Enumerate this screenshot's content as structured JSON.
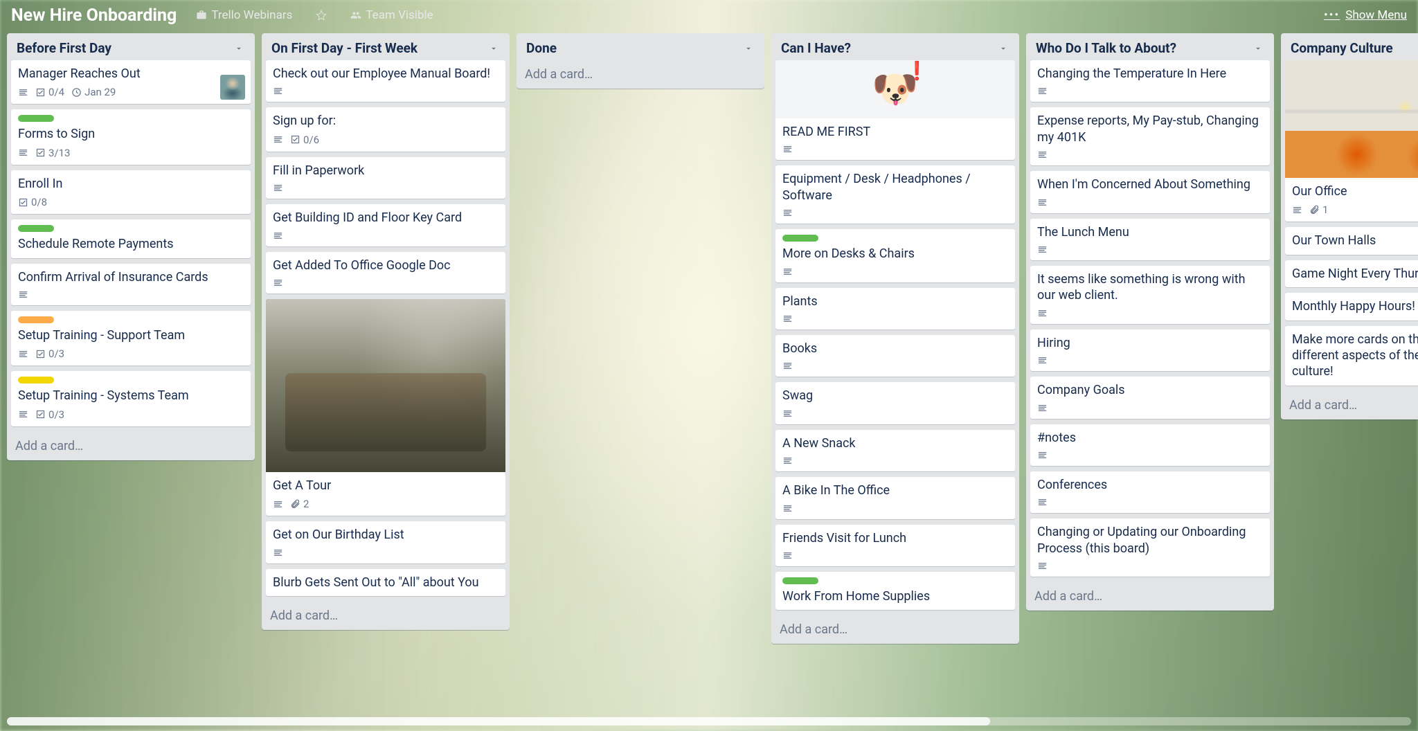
{
  "header": {
    "board_title": "New Hire Onboarding",
    "org_label": "Trello Webinars",
    "visibility_label": "Team Visible",
    "show_menu": "Show Menu"
  },
  "add_card_label": "Add a card…",
  "lists": [
    {
      "name": "Before First Day",
      "cards": [
        {
          "title": "Manager Reaches Out",
          "desc": true,
          "check": "0/4",
          "due": "Jan 29",
          "avatar": true
        },
        {
          "title": "Forms to Sign",
          "labels": [
            "green"
          ],
          "desc": true,
          "check": "3/13"
        },
        {
          "title": "Enroll In",
          "check": "0/8"
        },
        {
          "title": "Schedule Remote Payments",
          "labels": [
            "green"
          ]
        },
        {
          "title": "Confirm Arrival of Insurance Cards",
          "desc": true
        },
        {
          "title": "Setup Training - Support Team",
          "labels": [
            "orange"
          ],
          "desc": true,
          "check": "0/3"
        },
        {
          "title": "Setup Training - Systems Team",
          "labels": [
            "yellow"
          ],
          "desc": true,
          "check": "0/3"
        }
      ]
    },
    {
      "name": "On First Day - First Week",
      "cards": [
        {
          "title": "Check out our Employee Manual Board!",
          "desc": true
        },
        {
          "title": "Sign up for:",
          "desc": true,
          "check": "0/6"
        },
        {
          "title": "Fill in Paperwork",
          "desc": true
        },
        {
          "title": "Get Building ID and Floor Key Card",
          "desc": true
        },
        {
          "title": "Get Added To Office Google Doc",
          "desc": true
        },
        {
          "title": "Get A Tour",
          "desc": true,
          "attach": "2",
          "cover": "tour"
        },
        {
          "title": "Get on Our Birthday List",
          "desc": true
        },
        {
          "title": "Blurb Gets Sent Out to \"All\" about You"
        }
      ]
    },
    {
      "name": "Done",
      "cards": []
    },
    {
      "name": "Can I Have?",
      "cards": [
        {
          "title": "READ ME FIRST",
          "desc": true,
          "cover": "dog"
        },
        {
          "title": "Equipment / Desk / Headphones / Software",
          "desc": true
        },
        {
          "title": "More on Desks & Chairs",
          "labels": [
            "green"
          ],
          "desc": true
        },
        {
          "title": "Plants",
          "desc": true
        },
        {
          "title": "Books",
          "desc": true
        },
        {
          "title": "Swag",
          "desc": true
        },
        {
          "title": "A New Snack",
          "desc": true
        },
        {
          "title": "A Bike In The Office",
          "desc": true
        },
        {
          "title": "Friends Visit for Lunch",
          "desc": true
        },
        {
          "title": "Work From Home Supplies",
          "labels": [
            "green"
          ]
        }
      ]
    },
    {
      "name": "Who Do I Talk to About?",
      "cards": [
        {
          "title": "Changing the Temperature In Here",
          "desc": true
        },
        {
          "title": "Expense reports, My Pay-stub, Changing my 401K",
          "desc": true
        },
        {
          "title": "When I'm Concerned About Something",
          "desc": true
        },
        {
          "title": "The Lunch Menu",
          "desc": true
        },
        {
          "title": "It seems like something is wrong with our web client.",
          "desc": true
        },
        {
          "title": "Hiring",
          "desc": true
        },
        {
          "title": "Company Goals",
          "desc": true
        },
        {
          "title": "#notes",
          "desc": true
        },
        {
          "title": "Conferences",
          "desc": true
        },
        {
          "title": "Changing or Updating our Onboarding Process (this board)",
          "desc": true
        }
      ]
    },
    {
      "name": "Company Culture",
      "cards": [
        {
          "title": "Our Office",
          "desc": true,
          "attach": "1",
          "cover": "office"
        },
        {
          "title": "Our Town Halls"
        },
        {
          "title": "Game Night Every Thursday"
        },
        {
          "title": "Monthly Happy Hours!"
        },
        {
          "title": "Make more cards on this list to discuss different aspects of the company's culture!"
        }
      ]
    }
  ]
}
